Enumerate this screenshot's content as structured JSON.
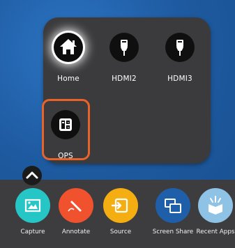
{
  "source_panel": {
    "sources": [
      {
        "label": "Home",
        "icon": "home-icon"
      },
      {
        "label": "HDMI2",
        "icon": "hdmi-icon"
      },
      {
        "label": "HDMI3",
        "icon": "hdmi-icon"
      },
      {
        "label": "OPS",
        "icon": "ops-pc-icon"
      }
    ],
    "selected": "OPS",
    "focus_color": "#e8632a"
  },
  "dock": {
    "expand_icon": "chevron-up-icon",
    "apps": [
      {
        "label": "Capture",
        "icon": "image-frame-icon",
        "color": "#27c6c6"
      },
      {
        "label": "Annotate",
        "icon": "pen-icon",
        "color": "#f0522e"
      },
      {
        "label": "Source",
        "icon": "input-arrow-icon",
        "color": "#f5ae12"
      },
      {
        "label": "Screen Share",
        "icon": "screen-share-icon",
        "color": "#1f5fa9"
      },
      {
        "label": "Recent Apps",
        "icon": "open-box-icon",
        "color": "#8ec3e6"
      }
    ]
  }
}
